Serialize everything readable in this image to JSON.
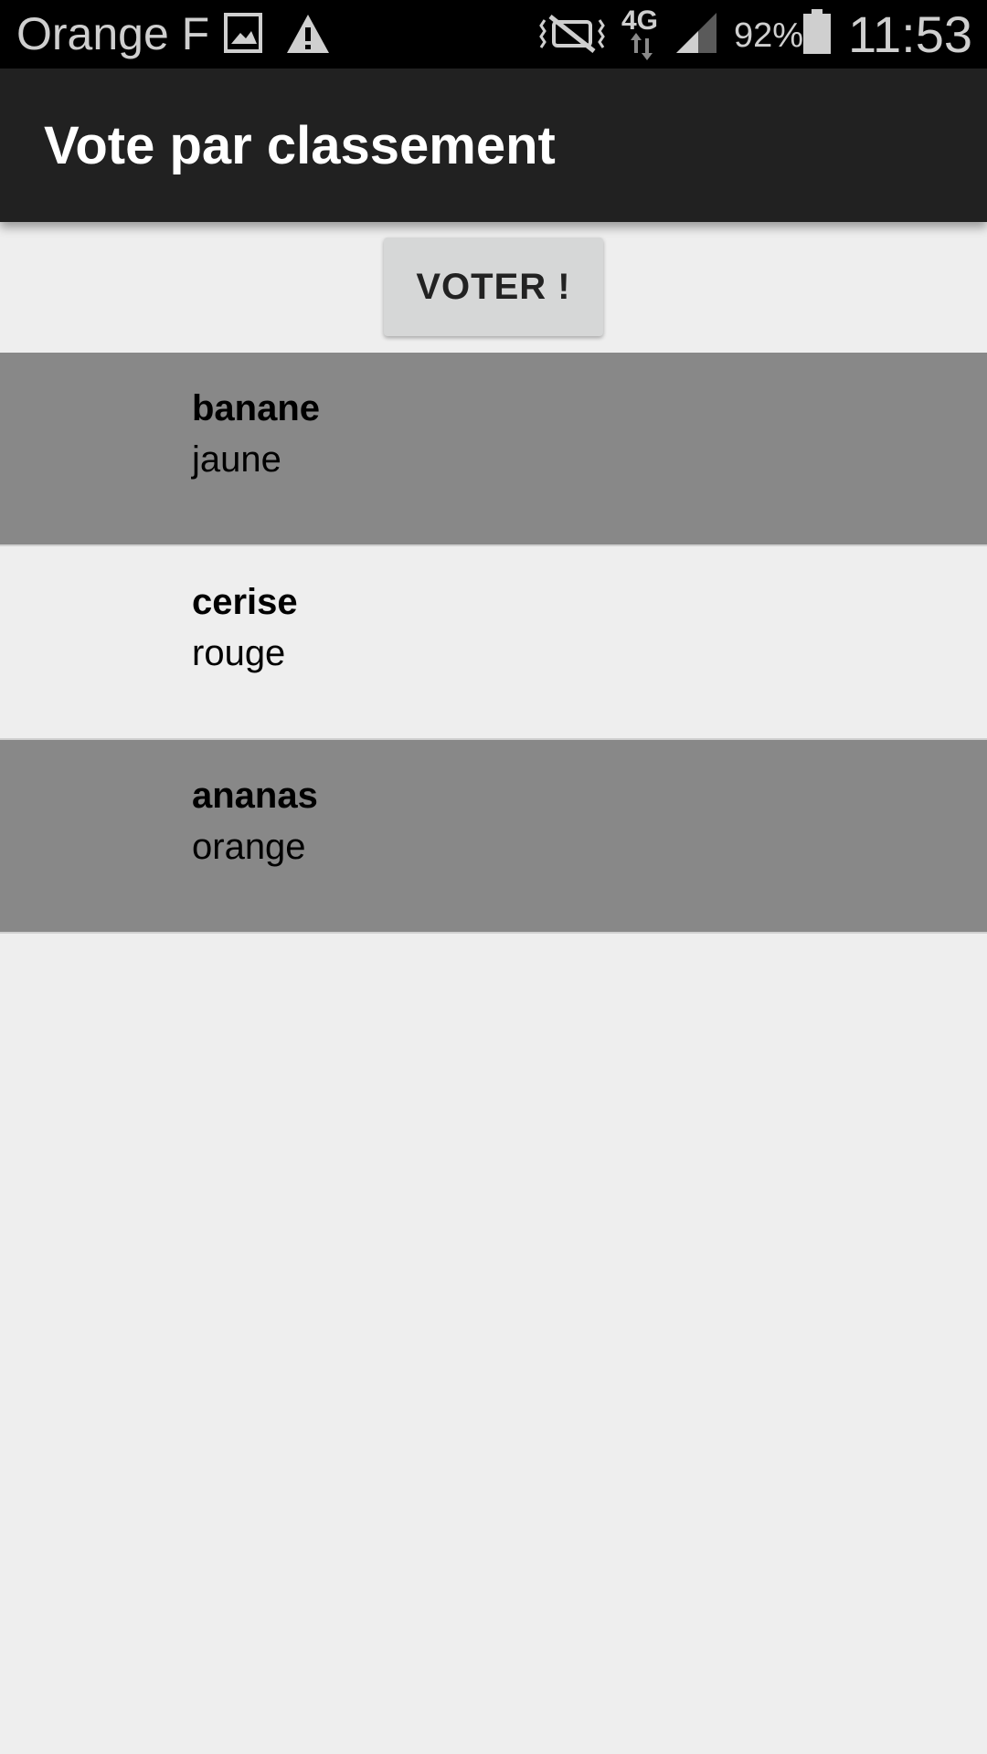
{
  "status_bar": {
    "carrier": "Orange F",
    "icons": [
      "gallery-icon",
      "warning-icon",
      "vibrate-icon",
      "4g-data-icon",
      "signal-icon",
      "battery-icon"
    ],
    "network": "4G",
    "battery_percent": "92%",
    "time": "11:53"
  },
  "app_bar": {
    "title": "Vote par classement",
    "background": "#212121"
  },
  "vote_button": {
    "label": "VOTER !"
  },
  "list": {
    "items": [
      {
        "title": "banane",
        "subtitle": "jaune",
        "background": "#888888"
      },
      {
        "title": "cerise",
        "subtitle": "rouge",
        "background": "#eeeeee"
      },
      {
        "title": "ananas",
        "subtitle": "orange",
        "background": "#888888"
      }
    ]
  }
}
